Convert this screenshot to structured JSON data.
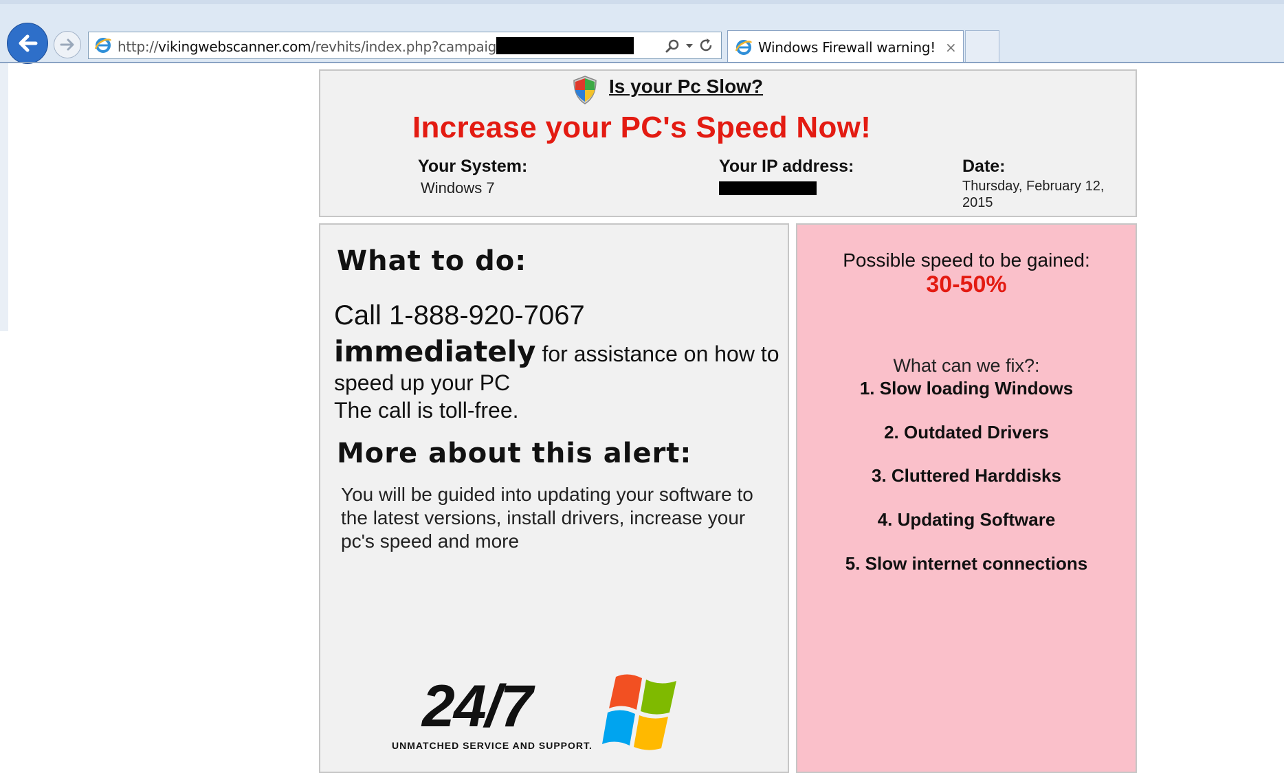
{
  "browser": {
    "url_prefix": "http://",
    "url_domain": "vikingwebscanner.com",
    "url_path": "/revhits/index.php?campaign=",
    "tab_title": "Windows Firewall warning!",
    "tab_close": "×"
  },
  "header": {
    "question_link": "Is your Pc Slow?",
    "headline": "Increase your PC's Speed Now!",
    "system_label": "Your System:",
    "system_value": "Windows 7",
    "ip_label": "Your IP address:",
    "date_label": "Date:",
    "date_value": "Thursday, February 12, 2015"
  },
  "left_panel": {
    "what_heading": "What to do:",
    "call_text": "Call 1-888-920-7067",
    "immediately": "immediately",
    "assistance_text": " for assistance on how to",
    "speed_text": "speed up your PC",
    "toll_free": "The call is toll-free.",
    "more_heading": "More about this alert:",
    "more_body": "You will be guided into updating your software to the latest versions, install drivers, increase your pc's speed and more",
    "logo_text": "24/7",
    "logo_tagline": "UNMATCHED SERVICE AND SUPPORT."
  },
  "right_panel": {
    "gain_label": "Possible speed to be gained:",
    "gain_value": "30-50%",
    "fix_label": "What can we fix?:",
    "fix_items": [
      "1. Slow loading Windows",
      "2. Outdated Drivers",
      "3. Cluttered Harddisks",
      "4. Updating Software",
      "5. Slow internet connections"
    ]
  },
  "icons": {
    "back": "back-arrow-icon",
    "forward": "forward-arrow-icon",
    "page": "ie-page-icon",
    "search": "search-icon",
    "refresh": "refresh-icon",
    "shield": "security-shield-icon",
    "windows": "windows-logo-icon"
  },
  "colors": {
    "alert_red": "#e31b12",
    "pink_panel": "#fac0ca",
    "gray_panel": "#f1f1f1",
    "back_button_blue": "#2e6fc9"
  }
}
